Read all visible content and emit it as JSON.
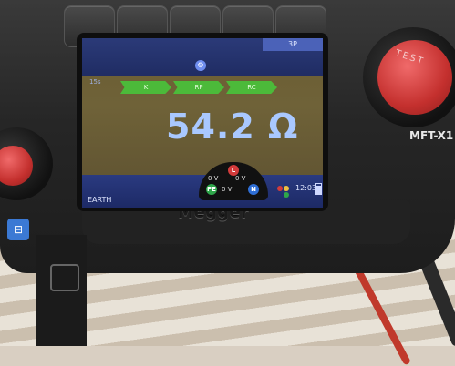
{
  "device": {
    "model": "MFT-X1",
    "brand": "Megger",
    "test_label": "TEST"
  },
  "screen": {
    "top_tab": "3P",
    "top_left": "15s",
    "settings_icon": "settings-gear-icon",
    "modes": [
      "K",
      "RP",
      "RC"
    ],
    "reading": "54.2 Ω",
    "bottom_left": "EARTH",
    "time": "12:03",
    "terminals": [
      {
        "label": "L",
        "color": "#d33b3b"
      },
      {
        "label": "PE",
        "color": "#2ea64a"
      },
      {
        "label": "N",
        "color": "#2f6fd6"
      }
    ],
    "voltages": [
      "0 V",
      "0 V",
      "0 V"
    ]
  },
  "colors": {
    "screen_bg": "#6a5d33",
    "mode_green": "#4cba3a",
    "reading_blue": "#a9c8ff",
    "knob_red": "#c4302e"
  }
}
